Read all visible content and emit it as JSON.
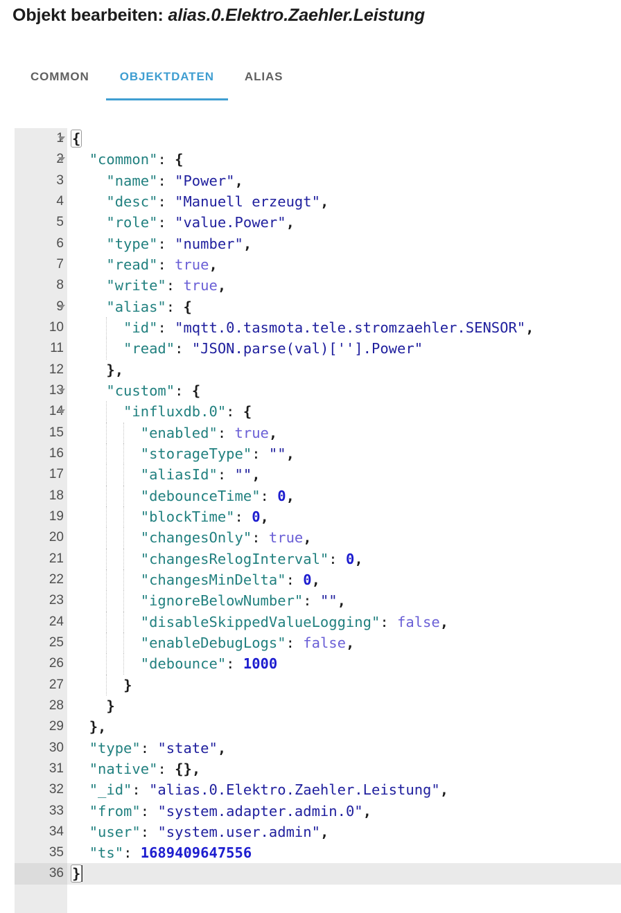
{
  "header": {
    "title_prefix": "Objekt bearbeiten: ",
    "object_id": "alias.0.Elektro.Zaehler.Leistung"
  },
  "tabs": [
    {
      "label": "COMMON",
      "active": false
    },
    {
      "label": "OBJEKTDATEN",
      "active": true
    },
    {
      "label": "ALIAS",
      "active": false
    }
  ],
  "colors": {
    "accent": "#3f9ed1",
    "tab_inactive": "#606060",
    "gutter_bg": "#ebebeb",
    "active_line_bg": "#eaeaea",
    "json_key": "#21807f",
    "json_string": "#20209e",
    "json_number": "#1d1dcf",
    "json_boolean": "#6a5fd6",
    "json_punct": "#1c1c1c"
  },
  "editor": {
    "language": "json",
    "total_lines": 36,
    "active_line": 36,
    "cursor_line": 36,
    "cursor_column": 2,
    "fold_markers": [
      1,
      2,
      9,
      13,
      14
    ],
    "gutter_line_numbers": [
      "1",
      "2",
      "3",
      "4",
      "5",
      "6",
      "7",
      "8",
      "9",
      "10",
      "11",
      "12",
      "13",
      "14",
      "15",
      "16",
      "17",
      "18",
      "19",
      "20",
      "21",
      "22",
      "23",
      "24",
      "25",
      "26",
      "27",
      "28",
      "29",
      "30",
      "31",
      "32",
      "33",
      "34",
      "35",
      "36"
    ],
    "lines": [
      {
        "n": 1,
        "indent": 0,
        "fold": true,
        "tokens": [
          {
            "t": "punct",
            "v": "{",
            "match": true
          }
        ]
      },
      {
        "n": 2,
        "indent": 1,
        "fold": true,
        "tokens": [
          {
            "t": "key",
            "v": "\"common\""
          },
          {
            "t": "colon",
            "v": ": "
          },
          {
            "t": "punct",
            "v": "{"
          }
        ]
      },
      {
        "n": 3,
        "indent": 2,
        "tokens": [
          {
            "t": "key",
            "v": "\"name\""
          },
          {
            "t": "colon",
            "v": ": "
          },
          {
            "t": "str",
            "v": "\"Power\""
          },
          {
            "t": "punct",
            "v": ","
          }
        ]
      },
      {
        "n": 4,
        "indent": 2,
        "tokens": [
          {
            "t": "key",
            "v": "\"desc\""
          },
          {
            "t": "colon",
            "v": ": "
          },
          {
            "t": "str",
            "v": "\"Manuell erzeugt\""
          },
          {
            "t": "punct",
            "v": ","
          }
        ]
      },
      {
        "n": 5,
        "indent": 2,
        "tokens": [
          {
            "t": "key",
            "v": "\"role\""
          },
          {
            "t": "colon",
            "v": ": "
          },
          {
            "t": "str",
            "v": "\"value.Power\""
          },
          {
            "t": "punct",
            "v": ","
          }
        ]
      },
      {
        "n": 6,
        "indent": 2,
        "tokens": [
          {
            "t": "key",
            "v": "\"type\""
          },
          {
            "t": "colon",
            "v": ": "
          },
          {
            "t": "str",
            "v": "\"number\""
          },
          {
            "t": "punct",
            "v": ","
          }
        ]
      },
      {
        "n": 7,
        "indent": 2,
        "tokens": [
          {
            "t": "key",
            "v": "\"read\""
          },
          {
            "t": "colon",
            "v": ": "
          },
          {
            "t": "bool",
            "v": "true"
          },
          {
            "t": "punct",
            "v": ","
          }
        ]
      },
      {
        "n": 8,
        "indent": 2,
        "tokens": [
          {
            "t": "key",
            "v": "\"write\""
          },
          {
            "t": "colon",
            "v": ": "
          },
          {
            "t": "bool",
            "v": "true"
          },
          {
            "t": "punct",
            "v": ","
          }
        ]
      },
      {
        "n": 9,
        "indent": 2,
        "fold": true,
        "tokens": [
          {
            "t": "key",
            "v": "\"alias\""
          },
          {
            "t": "colon",
            "v": ": "
          },
          {
            "t": "punct",
            "v": "{"
          }
        ]
      },
      {
        "n": 10,
        "indent": 3,
        "guides": [
          2
        ],
        "tokens": [
          {
            "t": "key",
            "v": "\"id\""
          },
          {
            "t": "colon",
            "v": ": "
          },
          {
            "t": "str",
            "v": "\"mqtt.0.tasmota.tele.stromzaehler.SENSOR\""
          },
          {
            "t": "punct",
            "v": ","
          }
        ]
      },
      {
        "n": 11,
        "indent": 3,
        "guides": [
          2
        ],
        "tokens": [
          {
            "t": "key",
            "v": "\"read\""
          },
          {
            "t": "colon",
            "v": ": "
          },
          {
            "t": "str",
            "v": "\"JSON.parse(val)[''].Power\""
          }
        ]
      },
      {
        "n": 12,
        "indent": 2,
        "tokens": [
          {
            "t": "punct",
            "v": "}"
          },
          {
            "t": "punct",
            "v": ","
          }
        ]
      },
      {
        "n": 13,
        "indent": 2,
        "fold": true,
        "tokens": [
          {
            "t": "key",
            "v": "\"custom\""
          },
          {
            "t": "colon",
            "v": ": "
          },
          {
            "t": "punct",
            "v": "{"
          }
        ]
      },
      {
        "n": 14,
        "indent": 3,
        "fold": true,
        "guides": [
          2
        ],
        "tokens": [
          {
            "t": "key",
            "v": "\"influxdb.0\""
          },
          {
            "t": "colon",
            "v": ": "
          },
          {
            "t": "punct",
            "v": "{"
          }
        ]
      },
      {
        "n": 15,
        "indent": 4,
        "guides": [
          2,
          3
        ],
        "tokens": [
          {
            "t": "key",
            "v": "\"enabled\""
          },
          {
            "t": "colon",
            "v": ": "
          },
          {
            "t": "bool",
            "v": "true"
          },
          {
            "t": "punct",
            "v": ","
          }
        ]
      },
      {
        "n": 16,
        "indent": 4,
        "guides": [
          2,
          3
        ],
        "tokens": [
          {
            "t": "key",
            "v": "\"storageType\""
          },
          {
            "t": "colon",
            "v": ": "
          },
          {
            "t": "str",
            "v": "\"\""
          },
          {
            "t": "punct",
            "v": ","
          }
        ]
      },
      {
        "n": 17,
        "indent": 4,
        "guides": [
          2,
          3
        ],
        "tokens": [
          {
            "t": "key",
            "v": "\"aliasId\""
          },
          {
            "t": "colon",
            "v": ": "
          },
          {
            "t": "str",
            "v": "\"\""
          },
          {
            "t": "punct",
            "v": ","
          }
        ]
      },
      {
        "n": 18,
        "indent": 4,
        "guides": [
          2,
          3
        ],
        "tokens": [
          {
            "t": "key",
            "v": "\"debounceTime\""
          },
          {
            "t": "colon",
            "v": ": "
          },
          {
            "t": "num",
            "v": "0"
          },
          {
            "t": "punct",
            "v": ","
          }
        ]
      },
      {
        "n": 19,
        "indent": 4,
        "guides": [
          2,
          3
        ],
        "tokens": [
          {
            "t": "key",
            "v": "\"blockTime\""
          },
          {
            "t": "colon",
            "v": ": "
          },
          {
            "t": "num",
            "v": "0"
          },
          {
            "t": "punct",
            "v": ","
          }
        ]
      },
      {
        "n": 20,
        "indent": 4,
        "guides": [
          2,
          3
        ],
        "tokens": [
          {
            "t": "key",
            "v": "\"changesOnly\""
          },
          {
            "t": "colon",
            "v": ": "
          },
          {
            "t": "bool",
            "v": "true"
          },
          {
            "t": "punct",
            "v": ","
          }
        ]
      },
      {
        "n": 21,
        "indent": 4,
        "guides": [
          2,
          3
        ],
        "tokens": [
          {
            "t": "key",
            "v": "\"changesRelogInterval\""
          },
          {
            "t": "colon",
            "v": ": "
          },
          {
            "t": "num",
            "v": "0"
          },
          {
            "t": "punct",
            "v": ","
          }
        ]
      },
      {
        "n": 22,
        "indent": 4,
        "guides": [
          2,
          3
        ],
        "tokens": [
          {
            "t": "key",
            "v": "\"changesMinDelta\""
          },
          {
            "t": "colon",
            "v": ": "
          },
          {
            "t": "num",
            "v": "0"
          },
          {
            "t": "punct",
            "v": ","
          }
        ]
      },
      {
        "n": 23,
        "indent": 4,
        "guides": [
          2,
          3
        ],
        "tokens": [
          {
            "t": "key",
            "v": "\"ignoreBelowNumber\""
          },
          {
            "t": "colon",
            "v": ": "
          },
          {
            "t": "str",
            "v": "\"\""
          },
          {
            "t": "punct",
            "v": ","
          }
        ]
      },
      {
        "n": 24,
        "indent": 4,
        "guides": [
          2,
          3
        ],
        "tokens": [
          {
            "t": "key",
            "v": "\"disableSkippedValueLogging\""
          },
          {
            "t": "colon",
            "v": ": "
          },
          {
            "t": "bool",
            "v": "false"
          },
          {
            "t": "punct",
            "v": ","
          }
        ]
      },
      {
        "n": 25,
        "indent": 4,
        "guides": [
          2,
          3
        ],
        "tokens": [
          {
            "t": "key",
            "v": "\"enableDebugLogs\""
          },
          {
            "t": "colon",
            "v": ": "
          },
          {
            "t": "bool",
            "v": "false"
          },
          {
            "t": "punct",
            "v": ","
          }
        ]
      },
      {
        "n": 26,
        "indent": 4,
        "guides": [
          2,
          3
        ],
        "tokens": [
          {
            "t": "key",
            "v": "\"debounce\""
          },
          {
            "t": "colon",
            "v": ": "
          },
          {
            "t": "num",
            "v": "1000"
          }
        ]
      },
      {
        "n": 27,
        "indent": 3,
        "guides": [
          2
        ],
        "tokens": [
          {
            "t": "punct",
            "v": "}"
          }
        ]
      },
      {
        "n": 28,
        "indent": 2,
        "tokens": [
          {
            "t": "punct",
            "v": "}"
          }
        ]
      },
      {
        "n": 29,
        "indent": 1,
        "tokens": [
          {
            "t": "punct",
            "v": "}"
          },
          {
            "t": "punct",
            "v": ","
          }
        ]
      },
      {
        "n": 30,
        "indent": 1,
        "tokens": [
          {
            "t": "key",
            "v": "\"type\""
          },
          {
            "t": "colon",
            "v": ": "
          },
          {
            "t": "str",
            "v": "\"state\""
          },
          {
            "t": "punct",
            "v": ","
          }
        ]
      },
      {
        "n": 31,
        "indent": 1,
        "tokens": [
          {
            "t": "key",
            "v": "\"native\""
          },
          {
            "t": "colon",
            "v": ": "
          },
          {
            "t": "punct",
            "v": "{}"
          },
          {
            "t": "punct",
            "v": ","
          }
        ]
      },
      {
        "n": 32,
        "indent": 1,
        "tokens": [
          {
            "t": "key",
            "v": "\"_id\""
          },
          {
            "t": "colon",
            "v": ": "
          },
          {
            "t": "str",
            "v": "\"alias.0.Elektro.Zaehler.Leistung\""
          },
          {
            "t": "punct",
            "v": ","
          }
        ]
      },
      {
        "n": 33,
        "indent": 1,
        "tokens": [
          {
            "t": "key",
            "v": "\"from\""
          },
          {
            "t": "colon",
            "v": ": "
          },
          {
            "t": "str",
            "v": "\"system.adapter.admin.0\""
          },
          {
            "t": "punct",
            "v": ","
          }
        ]
      },
      {
        "n": 34,
        "indent": 1,
        "tokens": [
          {
            "t": "key",
            "v": "\"user\""
          },
          {
            "t": "colon",
            "v": ": "
          },
          {
            "t": "str",
            "v": "\"system.user.admin\""
          },
          {
            "t": "punct",
            "v": ","
          }
        ]
      },
      {
        "n": 35,
        "indent": 1,
        "tokens": [
          {
            "t": "key",
            "v": "\"ts\""
          },
          {
            "t": "colon",
            "v": ": "
          },
          {
            "t": "num",
            "v": "1689409647556"
          }
        ]
      },
      {
        "n": 36,
        "indent": 0,
        "active": true,
        "cursor": true,
        "tokens": [
          {
            "t": "punct",
            "v": "}",
            "match": true
          }
        ]
      }
    ]
  },
  "json_document": {
    "common": {
      "name": "Power",
      "desc": "Manuell erzeugt",
      "role": "value.Power",
      "type": "number",
      "read": true,
      "write": true,
      "alias": {
        "id": "mqtt.0.tasmota.tele.stromzaehler.SENSOR",
        "read": "JSON.parse(val)[''].Power"
      },
      "custom": {
        "influxdb.0": {
          "enabled": true,
          "storageType": "",
          "aliasId": "",
          "debounceTime": 0,
          "blockTime": 0,
          "changesOnly": true,
          "changesRelogInterval": 0,
          "changesMinDelta": 0,
          "ignoreBelowNumber": "",
          "disableSkippedValueLogging": false,
          "enableDebugLogs": false,
          "debounce": 1000
        }
      }
    },
    "type": "state",
    "native": {},
    "_id": "alias.0.Elektro.Zaehler.Leistung",
    "from": "system.adapter.admin.0",
    "user": "system.user.admin",
    "ts": 1689409647556
  }
}
